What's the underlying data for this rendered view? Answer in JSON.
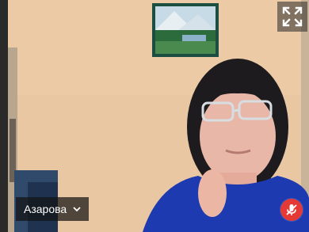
{
  "participant": {
    "name": "Азарова"
  },
  "controls": {
    "fullscreen_icon": "fullscreen-icon",
    "name_menu_icon": "chevron-down-icon",
    "mic_status_icon": "mic-muted-icon"
  },
  "colors": {
    "mic_muted_badge": "#e53935",
    "name_chip_background": "#141414"
  }
}
